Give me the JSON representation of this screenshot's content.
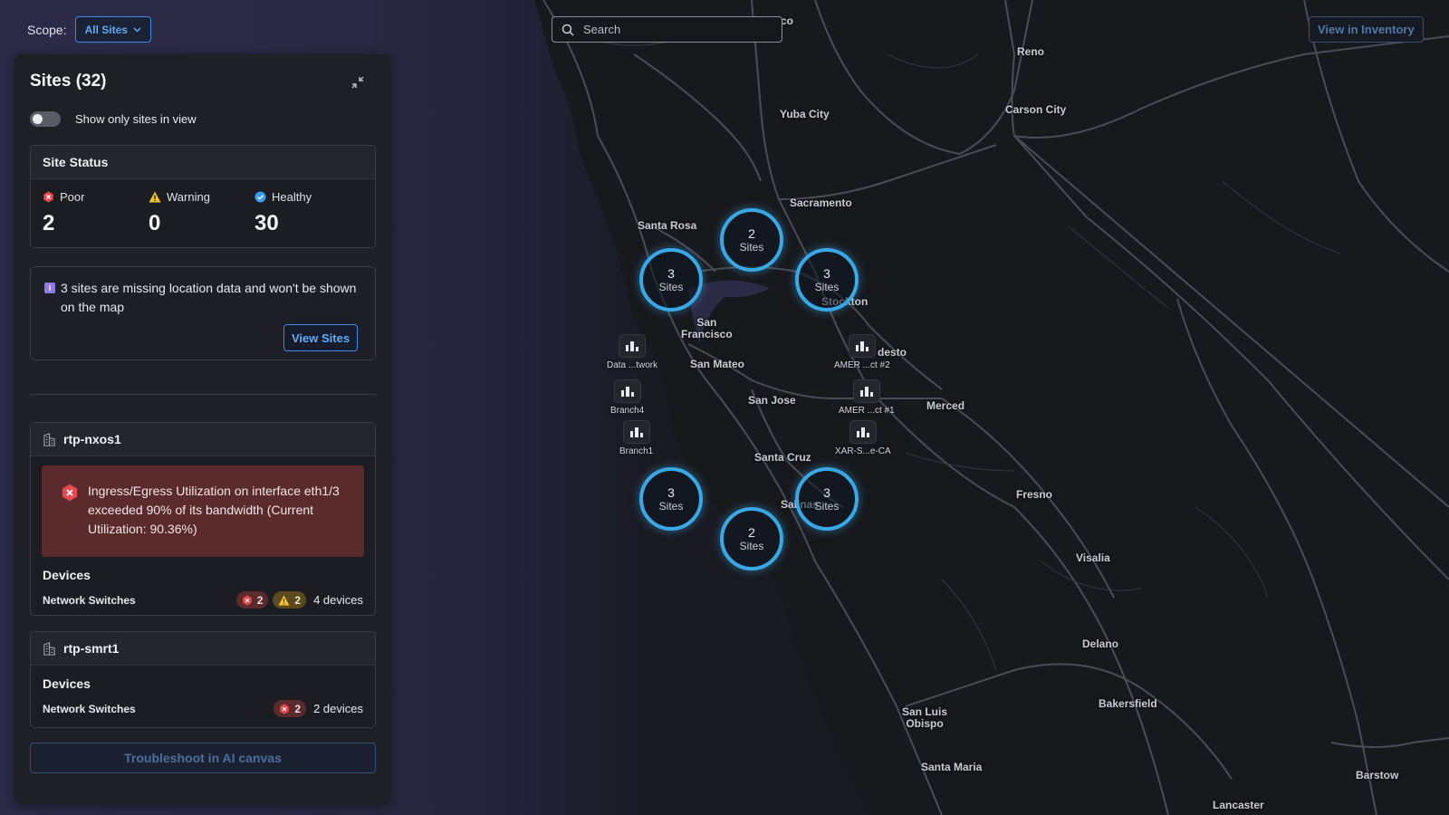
{
  "header": {
    "scope_label": "Scope:",
    "scope_value": "All Sites",
    "search_placeholder": "Search",
    "view_inventory_label": "View in Inventory"
  },
  "panel": {
    "title": "Sites (32)",
    "toggle_label": "Show only sites in view",
    "toggle_on": false,
    "site_status": {
      "title": "Site Status",
      "poor_label": "Poor",
      "poor_count": "2",
      "warning_label": "Warning",
      "warning_count": "0",
      "healthy_label": "Healthy",
      "healthy_count": "30"
    },
    "info": {
      "text": "3 sites are missing location data and won't be shown on the map",
      "button_label": "View Sites"
    },
    "sites": [
      {
        "name": "rtp-nxos1",
        "alert": "Ingress/Egress Utilization on interface eth1/3 exceeded 90% of its bandwidth (Current Utilization: 90.36%)",
        "devices_title": "Devices",
        "device_type": "Network Switches",
        "poor_badge": "2",
        "warning_badge": "2",
        "device_count": "4 devices"
      },
      {
        "name": "rtp-smrt1",
        "devices_title": "Devices",
        "device_type": "Network Switches",
        "poor_badge": "2",
        "device_count": "2 devices"
      }
    ],
    "troubleshoot_label": "Troubleshoot in AI canvas"
  },
  "map": {
    "cities": {
      "reno": "Reno",
      "carson_city": "Carson City",
      "yuba_city": "Yuba City",
      "sacramento": "Sacramento",
      "santa_rosa": "Santa Rosa",
      "stockton": "Stockton",
      "san_francisco": "San\nFrancisco",
      "san_mateo": "San Mateo",
      "modesto": "desto",
      "san_jose": "San Jose",
      "merced": "Merced",
      "santa_cruz": "Santa Cruz",
      "salinas": "Salinas",
      "fresno": "Fresno",
      "visalia": "Visalia",
      "delano": "Delano",
      "bakersfield": "Bakersfield",
      "san_luis_obispo": "San Luis\nObispo",
      "santa_maria": "Santa Maria",
      "barstow": "Barstow",
      "lancaster": "Lancaster",
      "top_partial": "co"
    },
    "clusters": [
      {
        "count": "2",
        "label": "Sites"
      },
      {
        "count": "3",
        "label": "Sites"
      },
      {
        "count": "3",
        "label": "Sites"
      },
      {
        "count": "3",
        "label": "Sites"
      },
      {
        "count": "3",
        "label": "Sites"
      },
      {
        "count": "2",
        "label": "Sites"
      }
    ],
    "pins": [
      {
        "label": "Data ...twork"
      },
      {
        "label": "Branch4"
      },
      {
        "label": "Branch1"
      },
      {
        "label": "AMER ...ct #2"
      },
      {
        "label": "AMER ...ct #1"
      },
      {
        "label": "XAR-S...e-CA"
      }
    ]
  },
  "colors": {
    "accent": "#38a9e6",
    "poor": "#e5484d",
    "warning": "#f2c037",
    "healthy": "#3b9cf0"
  }
}
